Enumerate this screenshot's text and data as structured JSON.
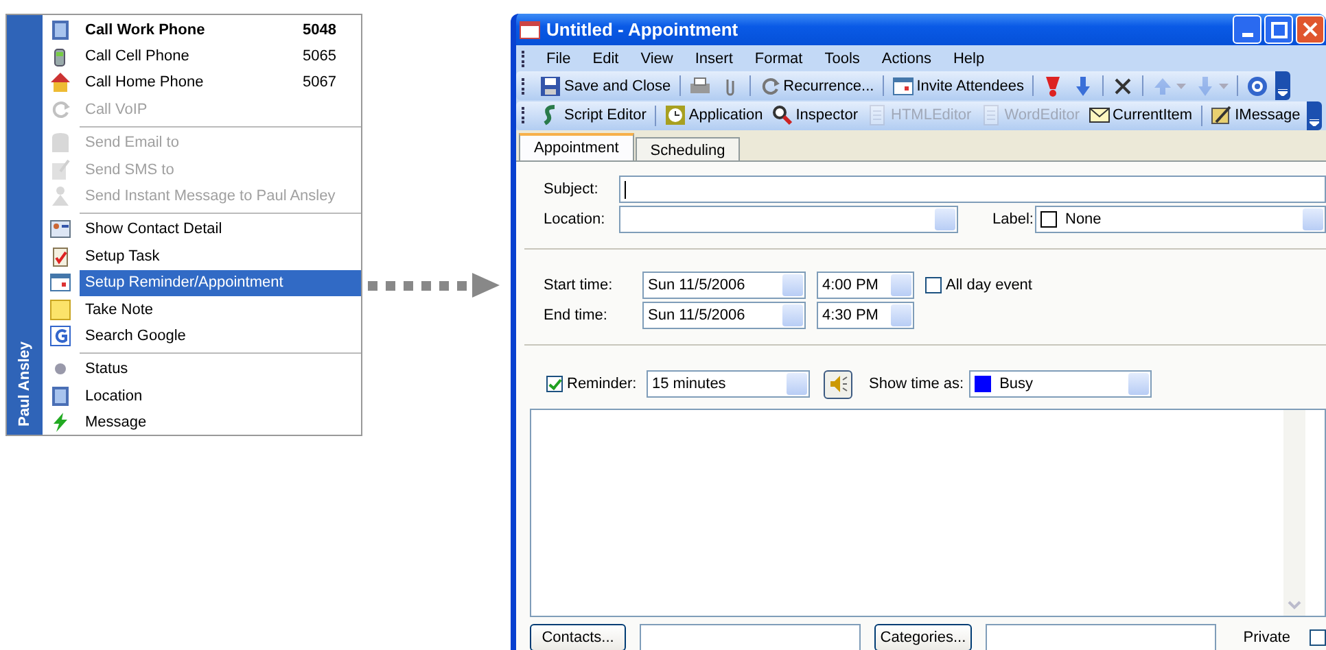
{
  "contact_menu": {
    "contact_name": "Paul Ansley",
    "groups": [
      [
        {
          "label": "Call Work Phone",
          "number": "5048",
          "bold": true,
          "disabled": false,
          "selected": false
        },
        {
          "label": "Call Cell Phone",
          "number": "5065",
          "bold": false,
          "disabled": false,
          "selected": false
        },
        {
          "label": "Call Home Phone",
          "number": "5067",
          "bold": false,
          "disabled": false,
          "selected": false
        },
        {
          "label": "Call VoIP",
          "bold": false,
          "disabled": true,
          "selected": false
        }
      ],
      [
        {
          "label": "Send Email to",
          "bold": false,
          "disabled": true,
          "selected": false
        },
        {
          "label": "Send SMS to",
          "bold": false,
          "disabled": true,
          "selected": false
        },
        {
          "label": "Send Instant Message to Paul Ansley",
          "bold": false,
          "disabled": true,
          "selected": false
        }
      ],
      [
        {
          "label": "Show Contact Detail",
          "bold": false,
          "disabled": false,
          "selected": false
        },
        {
          "label": "Setup Task",
          "bold": false,
          "disabled": false,
          "selected": false
        },
        {
          "label": "Setup Reminder/Appointment",
          "bold": false,
          "disabled": false,
          "selected": true
        },
        {
          "label": "Take Note",
          "bold": false,
          "disabled": false,
          "selected": false
        },
        {
          "label": "Search Google",
          "bold": false,
          "disabled": false,
          "selected": false
        }
      ],
      [
        {
          "label": "Status",
          "bold": false,
          "disabled": false,
          "selected": false
        },
        {
          "label": "Location",
          "bold": false,
          "disabled": false,
          "selected": false
        },
        {
          "label": "Message",
          "bold": false,
          "disabled": false,
          "selected": false
        }
      ]
    ]
  },
  "window": {
    "title": "Untitled - Appointment",
    "menu": [
      "File",
      "Edit",
      "View",
      "Insert",
      "Format",
      "Tools",
      "Actions",
      "Help"
    ],
    "toolbars": [
      [
        {
          "kind": "button",
          "label": "Save and Close",
          "disabled": false
        },
        {
          "kind": "separator"
        },
        {
          "kind": "button",
          "disabled": false
        },
        {
          "kind": "button",
          "disabled": false
        },
        {
          "kind": "separator"
        },
        {
          "kind": "button",
          "label": "Recurrence...",
          "disabled": false
        },
        {
          "kind": "separator"
        },
        {
          "kind": "button",
          "label": "Invite Attendees",
          "disabled": false
        },
        {
          "kind": "separator"
        },
        {
          "kind": "button",
          "disabled": false
        },
        {
          "kind": "button",
          "disabled": false
        },
        {
          "kind": "separator"
        },
        {
          "kind": "button",
          "disabled": false
        },
        {
          "kind": "separator"
        },
        {
          "kind": "dropdown",
          "disabled": true
        },
        {
          "kind": "dropdown",
          "disabled": true
        },
        {
          "kind": "separator"
        },
        {
          "kind": "button",
          "disabled": false
        }
      ],
      [
        {
          "kind": "button",
          "label": "Script Editor",
          "disabled": false
        },
        {
          "kind": "separator"
        },
        {
          "kind": "button",
          "label": "Application",
          "disabled": false
        },
        {
          "kind": "button",
          "label": "Inspector",
          "disabled": false
        },
        {
          "kind": "button",
          "label": "HTMLEditor",
          "disabled": true
        },
        {
          "kind": "button",
          "label": "WordEditor",
          "disabled": true
        },
        {
          "kind": "button",
          "label": "CurrentItem",
          "disabled": false
        },
        {
          "kind": "separator"
        },
        {
          "kind": "button",
          "label": "IMessage",
          "disabled": false
        }
      ]
    ],
    "tabs": [
      {
        "label": "Appointment",
        "selected": true
      },
      {
        "label": "Scheduling",
        "selected": false
      }
    ],
    "subject": {
      "label": "Subject:"
    },
    "location": {
      "label": "Location:"
    },
    "label_field": {
      "label": "Label:",
      "value": "None"
    },
    "start": {
      "label": "Start time:",
      "date": "Sun 11/5/2006",
      "time": "4:00 PM"
    },
    "end": {
      "label": "End time:",
      "date": "Sun 11/5/2006",
      "time": "4:30 PM"
    },
    "all_day": {
      "label": "All day event",
      "checked": false
    },
    "reminder": {
      "label": "Reminder:",
      "checked": true,
      "value": "15 minutes"
    },
    "show_time_as": {
      "label": "Show time as:",
      "value": "Busy"
    },
    "contacts_button": "Contacts...",
    "categories_button": "Categories...",
    "private": {
      "label": "Private",
      "checked": false
    }
  }
}
